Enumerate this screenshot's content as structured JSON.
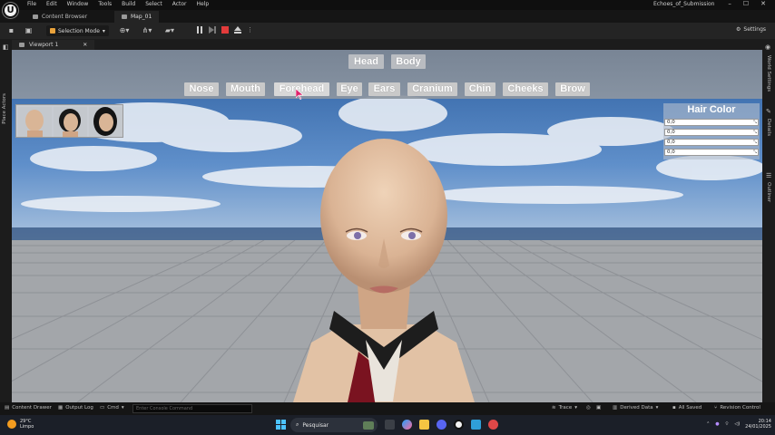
{
  "window": {
    "menu": [
      "File",
      "Edit",
      "Window",
      "Tools",
      "Build",
      "Select",
      "Actor",
      "Help"
    ],
    "project_name": "Echoes_of_Submission",
    "controls": [
      "–",
      "☐",
      "✕"
    ]
  },
  "tabs": [
    {
      "label": "Content Browser"
    },
    {
      "label": "Map_01"
    }
  ],
  "toolbar": {
    "mode_label": "Selection Mode",
    "settings_label": "Settings"
  },
  "side": {
    "left_label": "Place Actors",
    "right_labels": [
      "World Settings",
      "Details",
      "Outliner"
    ]
  },
  "viewport": {
    "tab_label": "Viewport 1",
    "close": "✕"
  },
  "game_ui": {
    "main_tabs": [
      "Head",
      "Body"
    ],
    "feature_tabs": [
      "Nose",
      "Mouth",
      "Forehead",
      "Eye",
      "Ears",
      "Cranium",
      "Chin",
      "Cheeks",
      "Brow"
    ],
    "hovered": "Forehead",
    "hair_panel": {
      "title": "Hair Color",
      "fields": [
        "0,0",
        "0,0",
        "0,0",
        "0,0"
      ]
    }
  },
  "statusbar": {
    "content_drawer": "Content Drawer",
    "output_log": "Output Log",
    "cmd": "Cmd",
    "console_placeholder": "Enter Console Command",
    "trace": "Trace",
    "derived_data": "Derived Data",
    "all_saved": "All Saved",
    "revision_control": "Revision Control"
  },
  "taskbar": {
    "temperature": "29°C",
    "weather": "Limpo",
    "search": "Pesquisar",
    "time": "20:14",
    "date": "24/01/2025"
  },
  "colors": {
    "accent_blue": "#4cc2ff",
    "stop_red": "#e23b3b",
    "sun_orange": "#f39c1f"
  }
}
